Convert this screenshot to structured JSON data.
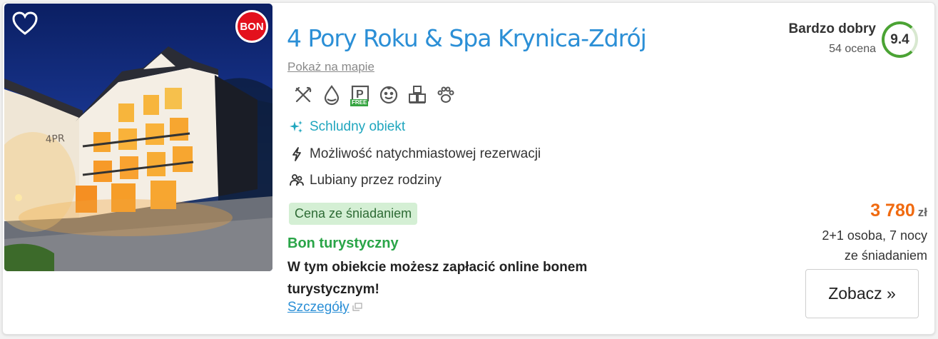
{
  "hotel": {
    "name": "4 Pory Roku & Spa Krynica-Zdrój",
    "map_link": "Pokaż na mapie",
    "bon_badge": "BON",
    "photo_logo": "4PR",
    "amenities": [
      {
        "icon": "restaurant-icon"
      },
      {
        "icon": "spa-icon"
      },
      {
        "icon": "free-parking-icon",
        "tag": "FREE"
      },
      {
        "icon": "kids-icon"
      },
      {
        "icon": "playroom-icon"
      },
      {
        "icon": "pets-icon"
      }
    ],
    "features": {
      "clean": "Schludny obiekt",
      "instant": "Możliwość natychmiastowej rezerwacji",
      "family": "Lubiany przez rodziny"
    },
    "breakfast_badge": "Cena ze śniadaniem",
    "bon": {
      "title": "Bon turystyczny",
      "description": "W tym obiekcie możesz zapłacić online bonem turystycznym!",
      "details_link": "Szczegóły"
    }
  },
  "rating": {
    "label": "Bardzo dobry",
    "count": "54 ocena",
    "score": "9.4"
  },
  "price": {
    "amount": "3 780",
    "currency": "zł",
    "guests": "2+1 osoba, 7 nocy",
    "board": "ze śniadaniem",
    "cta": "Zobacz »"
  },
  "colors": {
    "title": "#2b8fd6",
    "clean": "#1fa6be",
    "price": "#f06a10",
    "bon_green": "#2aa548",
    "score_ring": "#4ba334",
    "bon_badge": "#e3111d"
  }
}
